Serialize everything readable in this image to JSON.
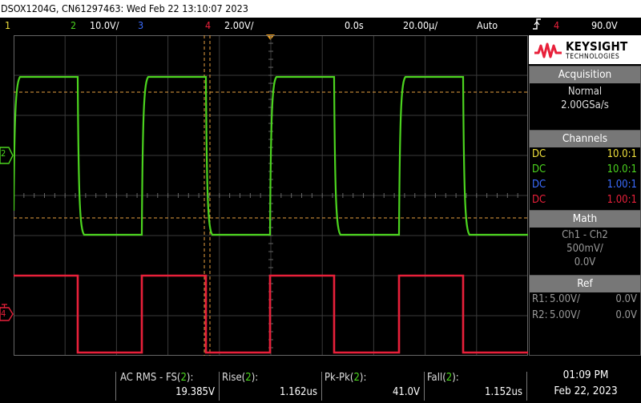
{
  "title_bar": "DSOX1204G, CN61297463: Wed Feb 22 13:10:07 2023",
  "channel_bar": {
    "ch1_num": "1",
    "ch2_num": "2",
    "ch2_scale": "10.0V/",
    "ch3_num": "3",
    "ch4_num": "4",
    "ch4_scale": "2.00V/",
    "time_delay": "0.0s",
    "time_scale": "20.00µ/",
    "trigger_mode": "Auto",
    "trigger_icon": "trigger-edge-icon",
    "trigger_channel": "4",
    "trigger_level": "90.0V"
  },
  "ground_markers": {
    "ch2": "2",
    "ch4": "4"
  },
  "brand": {
    "name": "KEYSIGHT",
    "sub": "TECHNOLOGIES",
    "color": "#e8203a"
  },
  "acquisition": {
    "heading": "Acquisition",
    "mode": "Normal",
    "rate": "2.00GSa/s"
  },
  "channels": {
    "heading": "Channels",
    "rows": [
      {
        "coupling": "DC",
        "probe": "10.0:1",
        "color": "#f0e03c"
      },
      {
        "coupling": "DC",
        "probe": "10.0:1",
        "color": "#4cd41f"
      },
      {
        "coupling": "DC",
        "probe": "1.00:1",
        "color": "#3b6cff"
      },
      {
        "coupling": "DC",
        "probe": "1.00:1",
        "color": "#e8203a"
      }
    ]
  },
  "math": {
    "heading": "Math",
    "func": "Ch1 - Ch2",
    "scale": "500mV/",
    "offset": "0.0V"
  },
  "ref": {
    "heading": "Ref",
    "r1_label": "R1:",
    "r1_scale": "5.00V/",
    "r1_offset": "0.0V",
    "r2_label": "R2:",
    "r2_scale": "5.00V/",
    "r2_offset": "0.0V"
  },
  "measurements": [
    {
      "label": "AC RMS - FS(",
      "ch": "2",
      "close": "):",
      "value": "19.385V"
    },
    {
      "label": "Rise(",
      "ch": "2",
      "close": "):",
      "value": "1.162us"
    },
    {
      "label": "Pk-Pk(",
      "ch": "2",
      "close": "):",
      "value": "41.0V"
    },
    {
      "label": "Fall(",
      "ch": "2",
      "close": "):",
      "value": "1.152us"
    }
  ],
  "clock": {
    "time": "01:09 PM",
    "date": "Feb 22, 2023"
  },
  "trace_colors": {
    "ch2": "#4cd41f",
    "ch4": "#e8203a",
    "cursor": "#e8a040",
    "trigger_marker": "#f0a020"
  }
}
